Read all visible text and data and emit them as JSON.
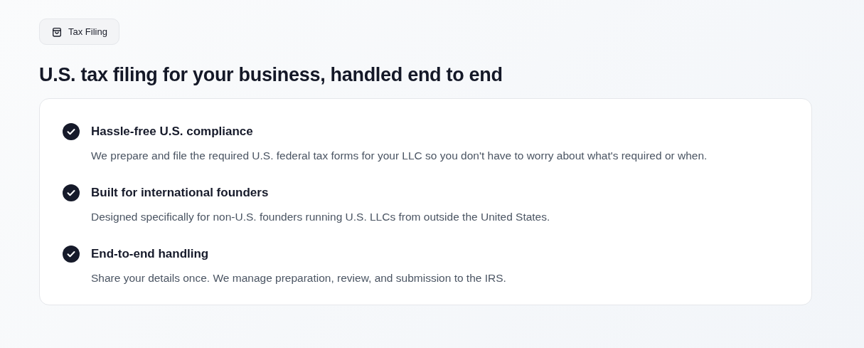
{
  "badge": {
    "label": "Tax Filing"
  },
  "heading": "U.S. tax filing for your business, handled end to end",
  "features": [
    {
      "title": "Hassle-free U.S. compliance",
      "description": "We prepare and file the required U.S. federal tax forms for your LLC so you don't have to worry about what's required or when."
    },
    {
      "title": "Built for international founders",
      "description": "Designed specifically for non-U.S. founders running U.S. LLCs from outside the United States."
    },
    {
      "title": "End-to-end handling",
      "description": "Share your details once. We manage preparation, review, and submission to the IRS."
    }
  ]
}
